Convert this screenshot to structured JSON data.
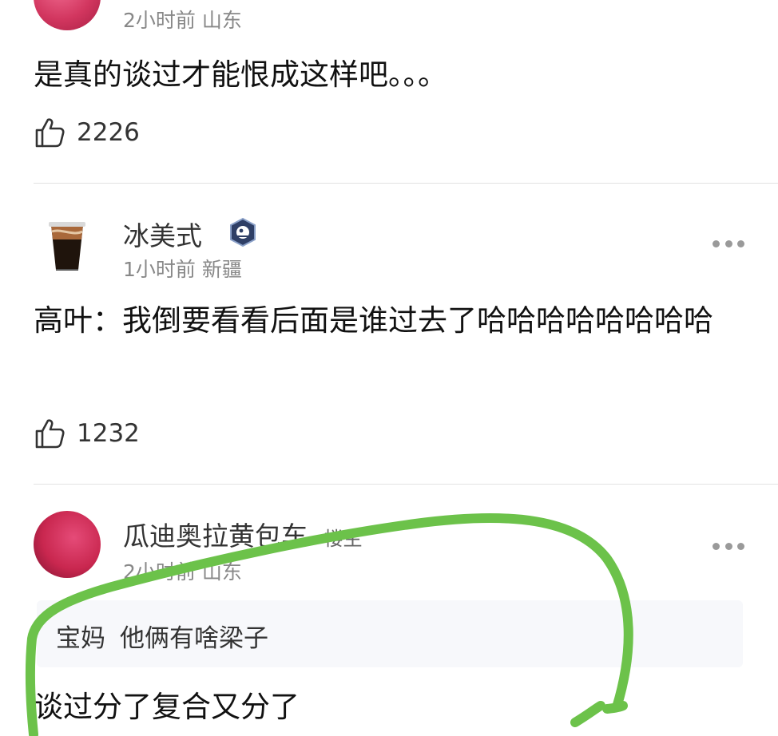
{
  "comments": [
    {
      "meta": "2小时前 山东",
      "text": "是真的谈过才能恨成这样吧。。。",
      "likes": "2226",
      "avatar_icon": "pink-avatar"
    },
    {
      "username": "冰美式",
      "meta": "1小时前 新疆",
      "text": "高叶：我倒要看看后面是谁过去了哈哈哈哈哈哈哈哈",
      "likes": "1232",
      "avatar_icon": "iced-coffee-avatar",
      "badge_icon": "level-badge-icon"
    },
    {
      "username": "瓜迪奥拉黄包车",
      "username_suffix": "楼主",
      "meta": "2小时前 山东",
      "reply": {
        "author": "宝妈",
        "text": "他俩有啥梁子"
      },
      "text": "谈过分了复合又分了",
      "avatar_icon": "pink-avatar"
    }
  ],
  "annotation": {
    "color": "#6cc24a",
    "shape": "hand-drawn-loop"
  },
  "colors": {
    "divider": "#e2e2e2",
    "meta_text": "#888888",
    "body_text": "#111111"
  }
}
